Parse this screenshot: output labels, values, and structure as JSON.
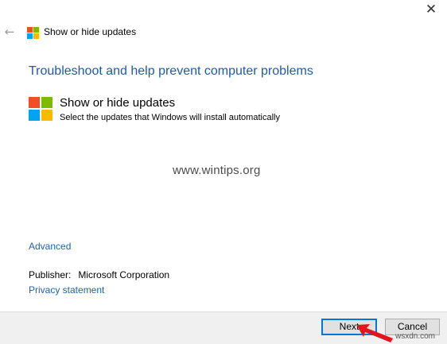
{
  "window": {
    "close_glyph": "✕",
    "back_glyph": "←",
    "title": "Show or hide updates",
    "brand_colors": {
      "red": "#f25022",
      "green": "#7fba00",
      "blue": "#00a4ef",
      "yellow": "#ffb900"
    }
  },
  "main": {
    "heading": "Troubleshoot and help prevent computer problems",
    "app_title": "Show or hide updates",
    "app_description": "Select the updates that Windows will install automatically",
    "watermark": "www.wintips.org",
    "advanced_link": "Advanced",
    "publisher_label": "Publisher:",
    "publisher_value": "Microsoft Corporation",
    "privacy_link": "Privacy statement"
  },
  "footer": {
    "next_label": "Next",
    "cancel_label": "Cancel",
    "corner_watermark": "wsxdn.com"
  }
}
